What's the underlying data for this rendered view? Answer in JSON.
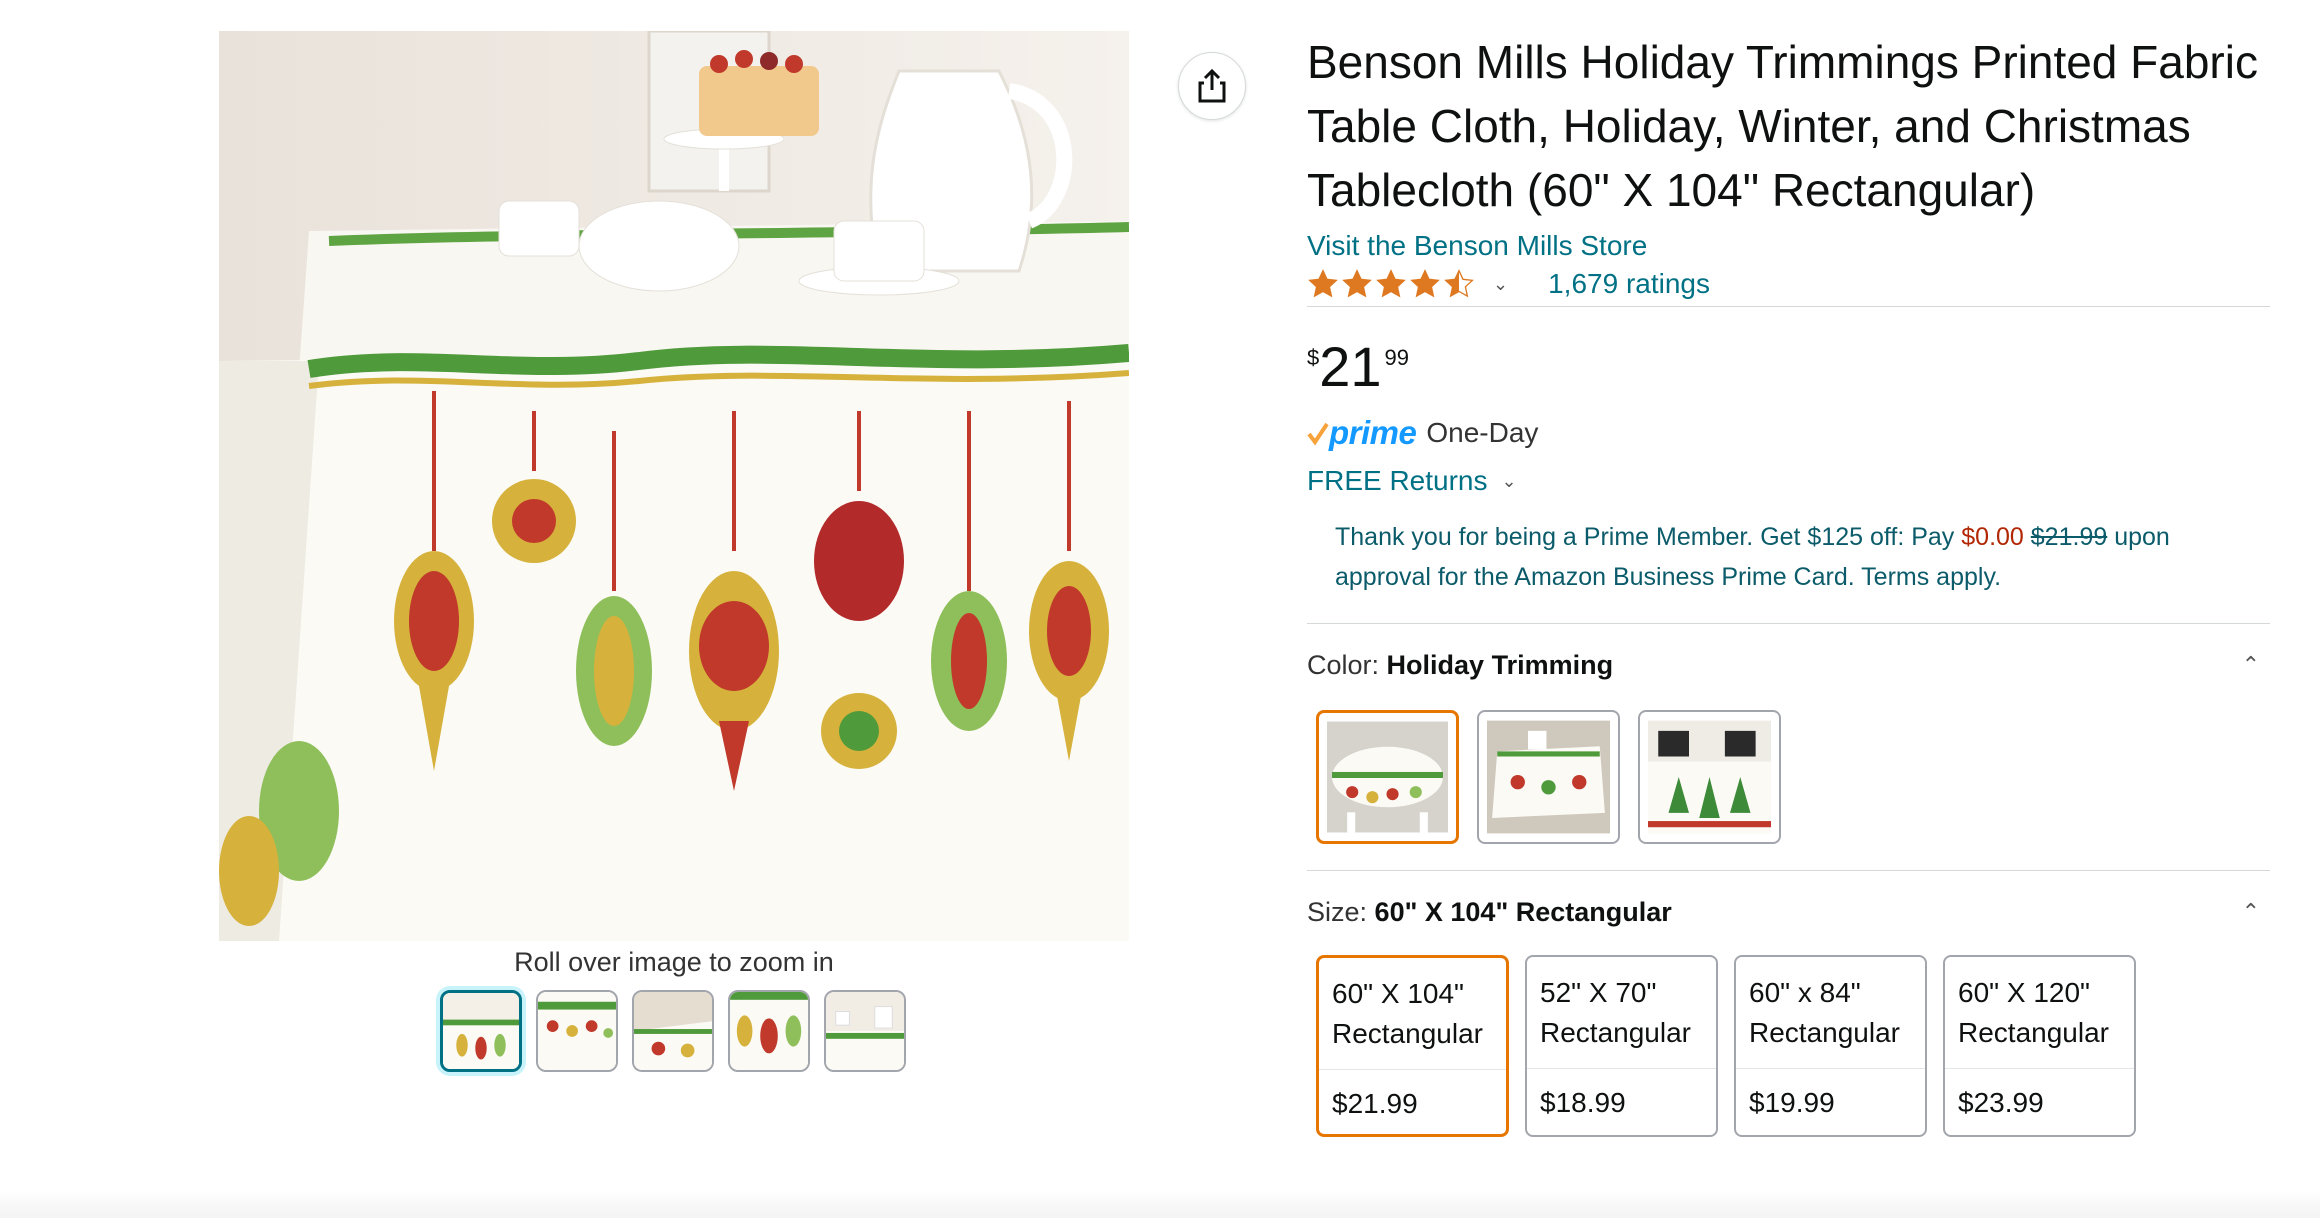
{
  "gallery": {
    "zoom_hint": "Roll over image to zoom in",
    "thumbnail_count": 5
  },
  "product": {
    "title": "Benson Mills Holiday Trimmings Printed Fabric Table Cloth, Holiday, Winter, and Christmas Tablecloth (60\" X 104\" Rectangular)",
    "store_link": "Visit the Benson Mills Store",
    "rating_stars": 4.5,
    "ratings_count": "1,679 ratings"
  },
  "price": {
    "symbol": "$",
    "whole": "21",
    "fraction": "99"
  },
  "delivery": {
    "prime_label": "prime",
    "one_day": "One-Day",
    "free_returns": "FREE Returns"
  },
  "promo": {
    "text_before": "Thank you for being a Prime Member. Get $125 off: Pay ",
    "pay_amount": "$0.00",
    "original_amount": "$21.99",
    "text_after": " upon approval for the Amazon Business Prime Card. Terms apply."
  },
  "color": {
    "label": "Color:",
    "selected": "Holiday Trimming",
    "swatch_count": 3
  },
  "size": {
    "label": "Size:",
    "selected": "60\" X 104\" Rectangular",
    "options": [
      {
        "dim": "60\" X 104\"",
        "shape": "Rectangular",
        "price": "$21.99"
      },
      {
        "dim": "52\" X 70\"",
        "shape": "Rectangular",
        "price": "$18.99"
      },
      {
        "dim": "60\" x 84\"",
        "shape": "Rectangular",
        "price": "$19.99"
      },
      {
        "dim": "60\" X 120\"",
        "shape": "Rectangular",
        "price": "$23.99"
      }
    ]
  },
  "colors": {
    "link": "#007185",
    "prime_blue": "#1399ff",
    "price_red": "#b12704",
    "selected_orange": "#e77600"
  },
  "icons": {
    "share": "share-icon",
    "chevron": "chevron-down-icon",
    "collapse": "chevron-up-icon",
    "prime_check": "prime-check-icon"
  }
}
